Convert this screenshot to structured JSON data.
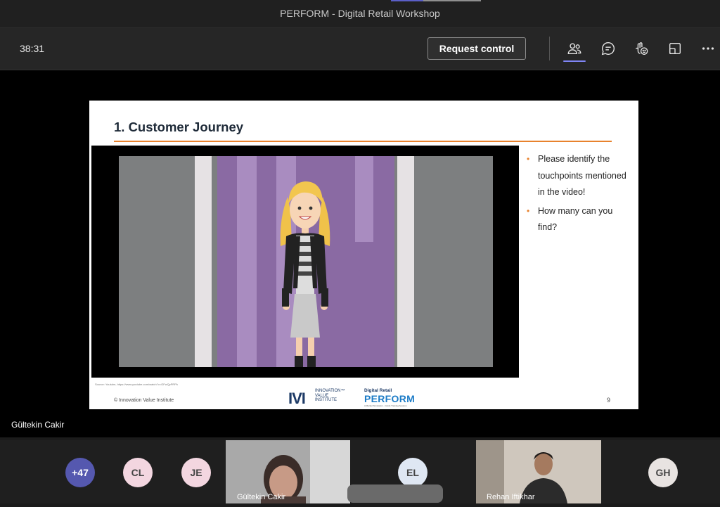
{
  "window": {
    "title": "PERFORM - Digital Retail Workshop"
  },
  "toolbar": {
    "timer": "38:31",
    "request_control_label": "Request control",
    "icons": [
      "people-icon",
      "chat-icon",
      "reactions-icon",
      "share-tray-icon",
      "more-icon"
    ]
  },
  "stage": {
    "presenter_name": "Gültekin Cakir"
  },
  "slide": {
    "title": "1. Customer Journey",
    "bullets": [
      "Please identify the touchpoints mentioned in the video!",
      "How many can you find?"
    ],
    "source": "Source: Youtube, https://www.youtube.com/watch?v=GFwQyPRPk",
    "copyright": "© Innovation Value Institute",
    "page_number": "9",
    "ivi_logo": {
      "mark": "IVI",
      "lines": [
        "INNOVATION™",
        "VALUE",
        "INSTITUTE"
      ]
    },
    "perform_logo": {
      "top": "Digital Retail",
      "big": "PERFORM",
      "sub": "A Market Simulation - Cards Training Session"
    }
  },
  "participants": {
    "overflow": "+47",
    "tiles": [
      {
        "initials": "CL"
      },
      {
        "initials": "JE"
      },
      {
        "name": "Gültekin Cakir"
      },
      {
        "initials": "EL"
      },
      {
        "name": "Rehan Iftikhar"
      },
      {
        "initials": "GH"
      }
    ]
  },
  "colors": {
    "accent": "#5b5fc7",
    "slide_rule": "#e8822d",
    "scene_purple": "#8a6aa3"
  }
}
